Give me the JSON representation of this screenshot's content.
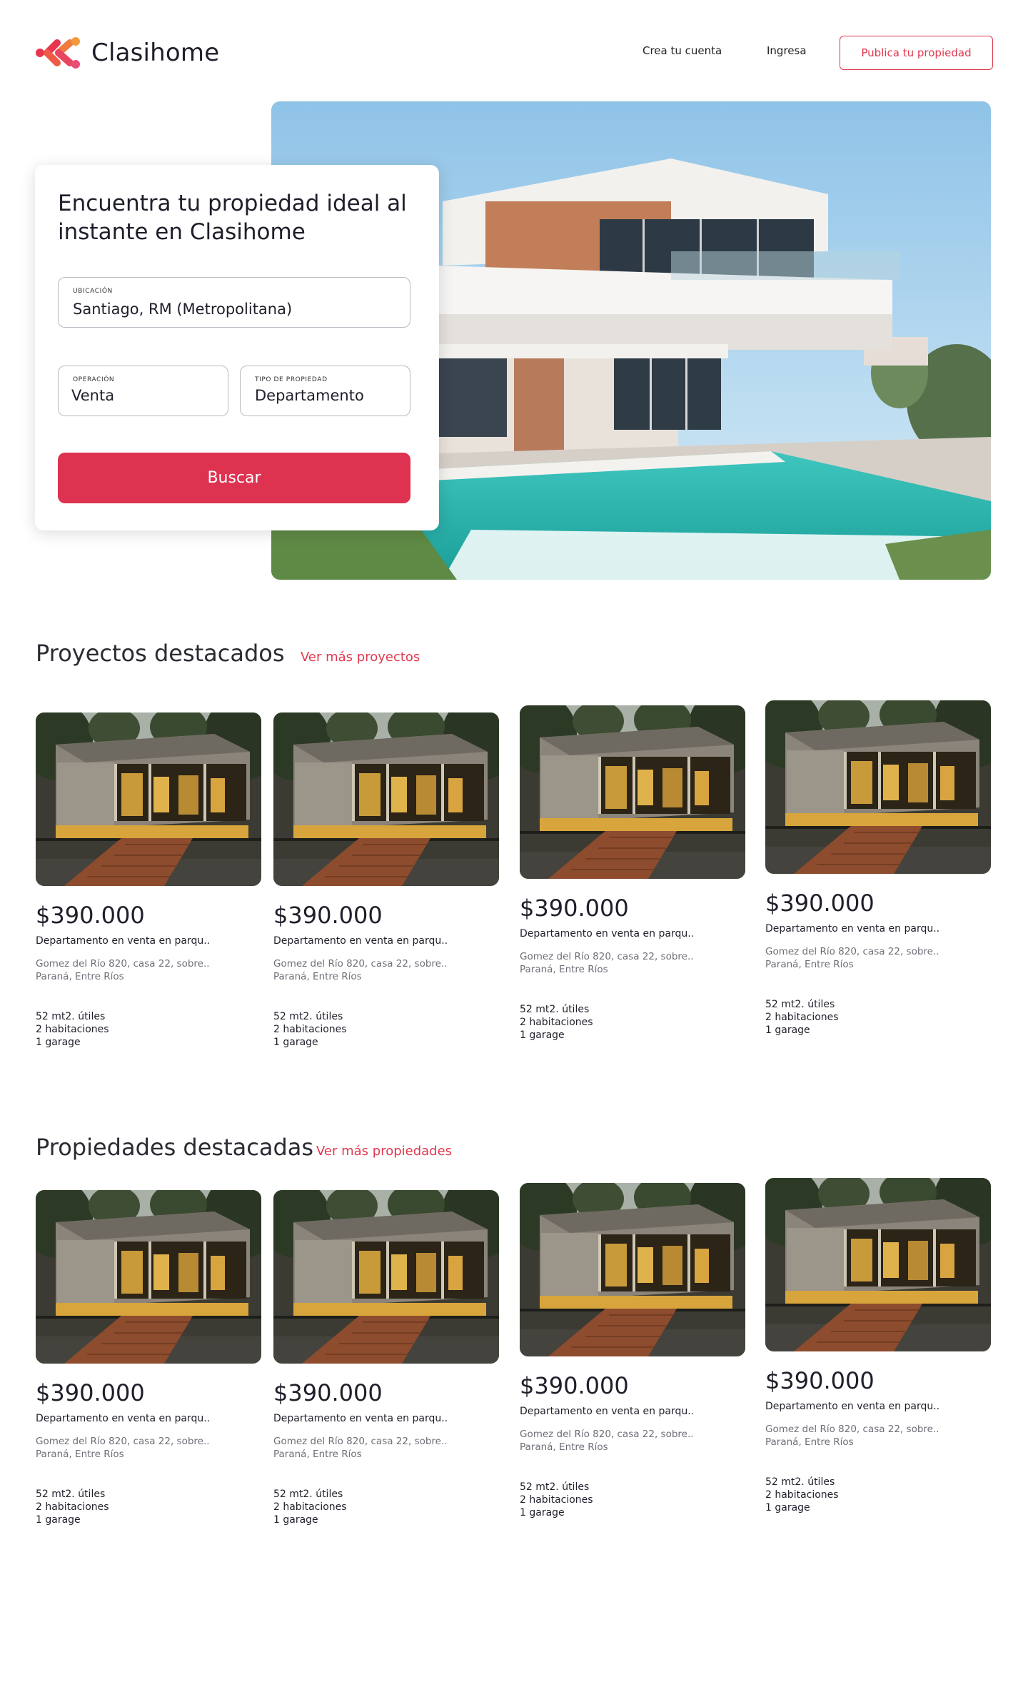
{
  "brand": {
    "name": "Clasihome",
    "colors": {
      "accent": "#dd3250",
      "text": "#1f1f2b"
    }
  },
  "nav": {
    "register": "Crea tu cuenta",
    "login": "Ingresa",
    "publish": "Publica tu propiedad"
  },
  "search": {
    "title": "Encuentra tu propiedad ideal al instante en Clasihome",
    "location_label": "UBICACIÓN",
    "location_value": "Santiago, RM (Metropolitana)",
    "operation_label": "OPERACIÓN",
    "operation_value": "Venta",
    "type_label": "TIPO DE PROPIEDAD",
    "type_value": "Departamento",
    "button": "Buscar"
  },
  "projects": {
    "title": "Proyectos destacados",
    "more_link": "Ver más proyectos",
    "cards": [
      {
        "price": "$390.000",
        "title": "Departamento en venta en parqu..",
        "address1": "Gomez del Río 820, casa 22, sobre..",
        "address2": "Paraná, Entre Ríos",
        "area": "52 mt2. útiles",
        "rooms": "2 habitaciones",
        "garage": "1 garage"
      },
      {
        "price": "$390.000",
        "title": "Departamento en venta en parqu..",
        "address1": "Gomez del Río 820, casa 22, sobre..",
        "address2": "Paraná, Entre Ríos",
        "area": "52 mt2. útiles",
        "rooms": "2 habitaciones",
        "garage": "1 garage"
      },
      {
        "price": "$390.000",
        "title": "Departamento en venta en parqu..",
        "address1": "Gomez del Río 820, casa 22, sobre..",
        "address2": "Paraná, Entre Ríos",
        "area": "52 mt2. útiles",
        "rooms": "2 habitaciones",
        "garage": "1 garage"
      },
      {
        "price": "$390.000",
        "title": "Departamento en venta en parqu..",
        "address1": "Gomez del Río 820, casa 22, sobre..",
        "address2": "Paraná, Entre Ríos",
        "area": "52 mt2. útiles",
        "rooms": "2 habitaciones",
        "garage": "1 garage"
      }
    ]
  },
  "properties": {
    "title": "Propiedades destacadas",
    "more_link": "Ver más propiedades",
    "cards": [
      {
        "price": "$390.000",
        "title": "Departamento en venta en parqu..",
        "address1": "Gomez del Río 820, casa 22, sobre..",
        "address2": "Paraná, Entre Ríos",
        "area": "52 mt2. útiles",
        "rooms": "2 habitaciones",
        "garage": "1 garage"
      },
      {
        "price": "$390.000",
        "title": "Departamento en venta en parqu..",
        "address1": "Gomez del Río 820, casa 22, sobre..",
        "address2": "Paraná, Entre Ríos",
        "area": "52 mt2. útiles",
        "rooms": "2 habitaciones",
        "garage": "1 garage"
      },
      {
        "price": "$390.000",
        "title": "Departamento en venta en parqu..",
        "address1": "Gomez del Río 820, casa 22, sobre..",
        "address2": "Paraná, Entre Ríos",
        "area": "52 mt2. útiles",
        "rooms": "2 habitaciones",
        "garage": "1 garage"
      },
      {
        "price": "$390.000",
        "title": "Departamento en venta en parqu..",
        "address1": "Gomez del Río 820, casa 22, sobre..",
        "address2": "Paraná, Entre Ríos",
        "area": "52 mt2. útiles",
        "rooms": "2 habitaciones",
        "garage": "1 garage"
      }
    ]
  }
}
